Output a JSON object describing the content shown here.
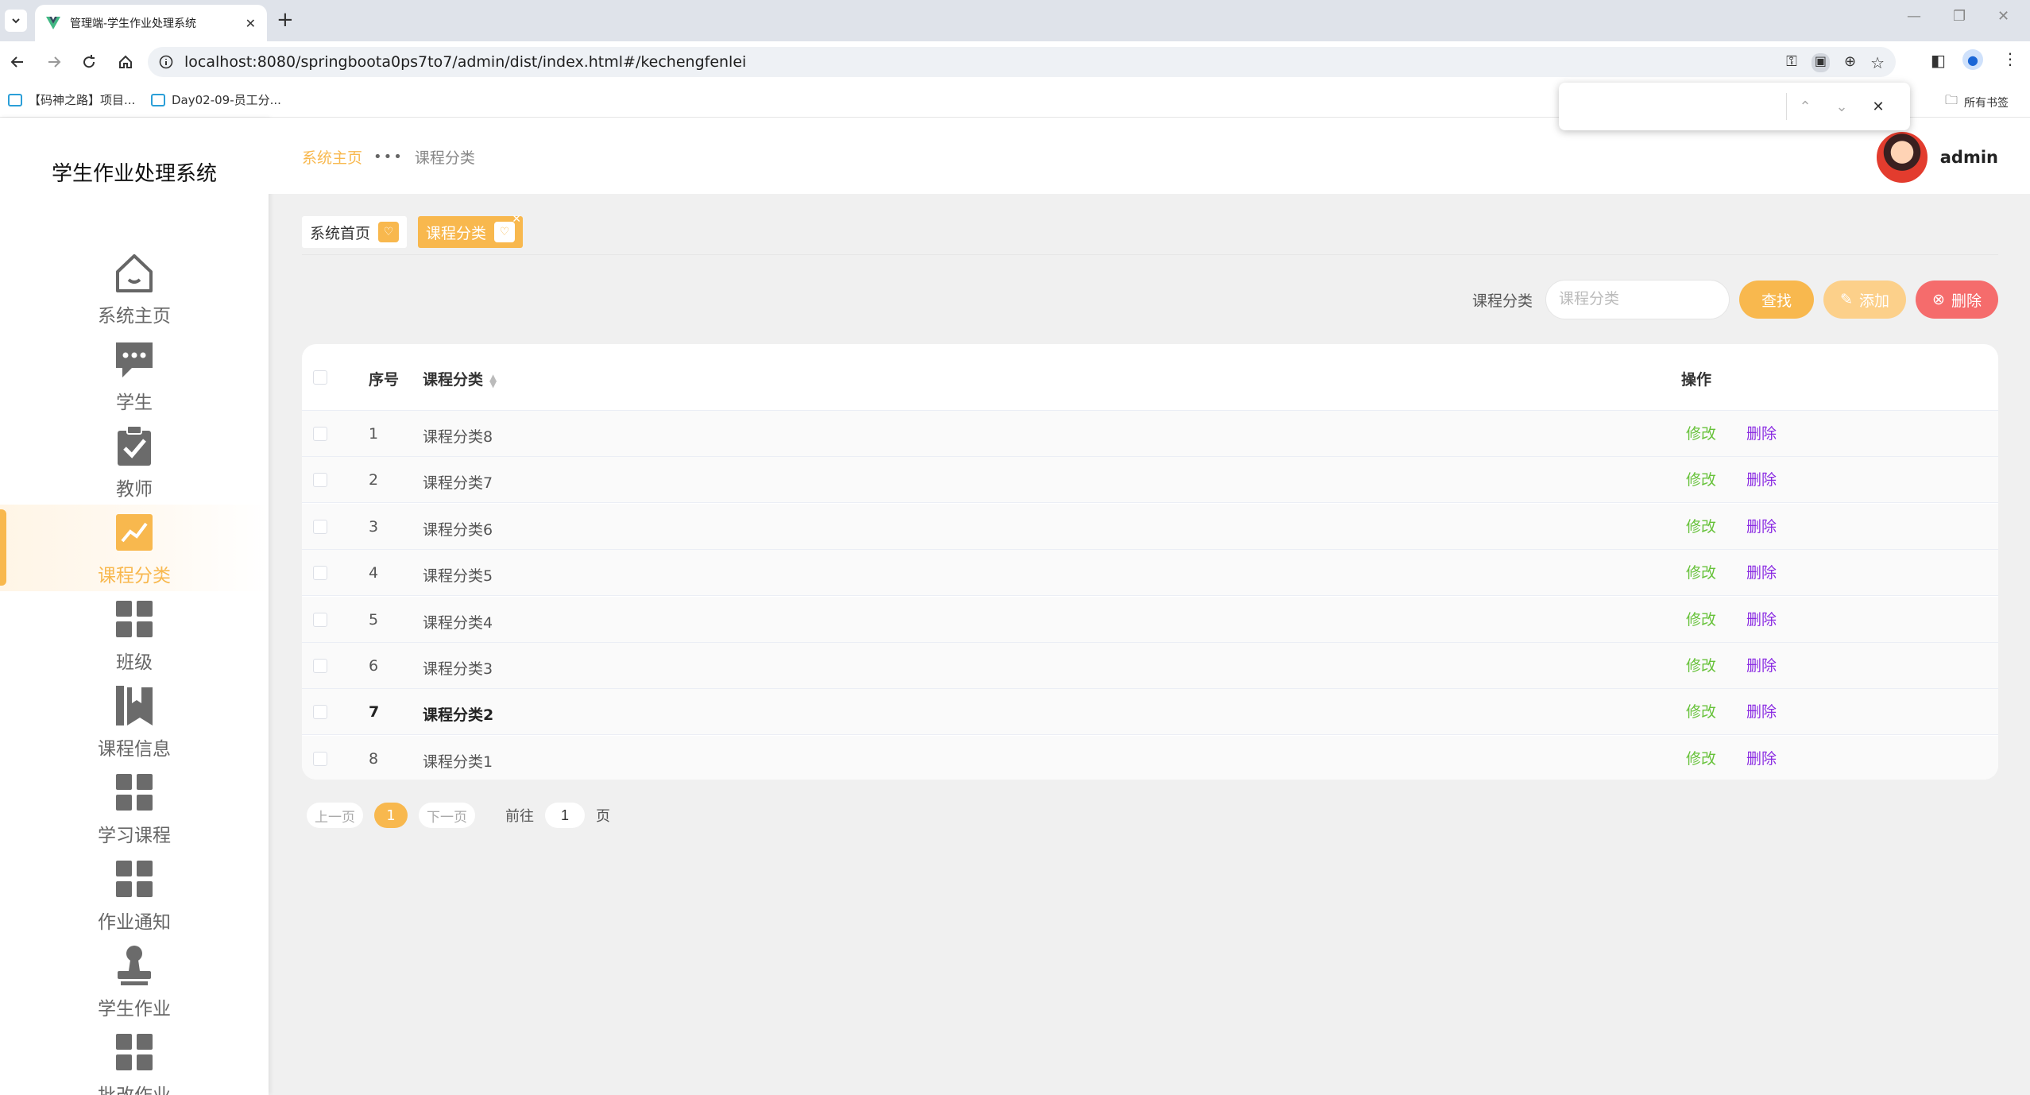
{
  "browser": {
    "tab_title": "管理端-学生作业处理系统",
    "url": "localhost:8080/springboota0ps7to7/admin/dist/index.html#/kechengfenlei",
    "bookmarks": [
      "【码神之路】项目...",
      "Day02-09-员工分..."
    ],
    "all_bookmarks_label": "所有书签"
  },
  "app": {
    "brand": "学生作业处理系统",
    "accent_color": "#f8b84e",
    "menu": [
      {
        "label": "系统主页",
        "icon": "home-icon"
      },
      {
        "label": "学生",
        "icon": "chat-icon"
      },
      {
        "label": "教师",
        "icon": "clipboard-check-icon"
      },
      {
        "label": "课程分类",
        "icon": "trend-chart-icon",
        "active": true
      },
      {
        "label": "班级",
        "icon": "grid-icon"
      },
      {
        "label": "课程信息",
        "icon": "books-icon"
      },
      {
        "label": "学习课程",
        "icon": "grid-icon"
      },
      {
        "label": "作业通知",
        "icon": "grid-icon"
      },
      {
        "label": "学生作业",
        "icon": "stamp-icon"
      },
      {
        "label": "批改作业",
        "icon": "grid-icon"
      }
    ],
    "breadcrumb": {
      "home": "系统主页",
      "sep": "•••",
      "current": "课程分类"
    },
    "user": {
      "name": "admin"
    },
    "tags": [
      {
        "label": "系统首页",
        "active": false
      },
      {
        "label": "课程分类",
        "active": true
      }
    ]
  },
  "search": {
    "label": "课程分类",
    "placeholder": "课程分类",
    "find_label": "查找",
    "add_label": "添加",
    "delete_label": "删除"
  },
  "table": {
    "headers": {
      "index": "序号",
      "category": "课程分类",
      "actions": "操作"
    },
    "edit_label": "修改",
    "delete_label": "删除",
    "rows": [
      {
        "index": "1",
        "category": "课程分类8"
      },
      {
        "index": "2",
        "category": "课程分类7"
      },
      {
        "index": "3",
        "category": "课程分类6"
      },
      {
        "index": "4",
        "category": "课程分类5"
      },
      {
        "index": "5",
        "category": "课程分类4"
      },
      {
        "index": "6",
        "category": "课程分类3"
      },
      {
        "index": "7",
        "category": "课程分类2"
      },
      {
        "index": "8",
        "category": "课程分类1"
      }
    ]
  },
  "pagination": {
    "prev": "上一页",
    "current": "1",
    "next": "下一页",
    "goto_label": "前往",
    "goto_value": "1",
    "page_suffix": "页"
  }
}
